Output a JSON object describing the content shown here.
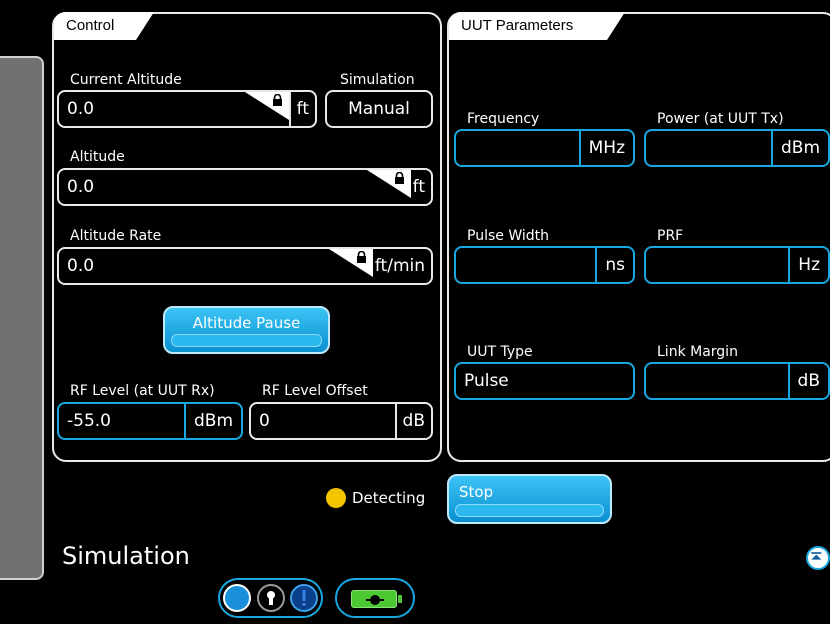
{
  "control": {
    "title": "Control",
    "current_altitude": {
      "label": "Current Altitude",
      "value": "0.0",
      "unit": "ft"
    },
    "simulation": {
      "label": "Simulation",
      "value": "Manual"
    },
    "altitude": {
      "label": "Altitude",
      "value": "0.0",
      "unit": "ft"
    },
    "altitude_rate": {
      "label": "Altitude Rate",
      "value": "0.0",
      "unit": "ft/min"
    },
    "altitude_pause_label": "Altitude Pause",
    "rf_level": {
      "label": "RF Level (at UUT Rx)",
      "value": "-55.0",
      "unit": "dBm"
    },
    "rf_level_offset": {
      "label": "RF Level Offset",
      "value": "0",
      "unit": "dB"
    }
  },
  "uut": {
    "title": "UUT Parameters",
    "frequency": {
      "label": "Frequency",
      "value": "",
      "unit": "MHz"
    },
    "power": {
      "label": "Power (at UUT Tx)",
      "value": "",
      "unit": "dBm"
    },
    "pulse_width": {
      "label": "Pulse Width",
      "value": "",
      "unit": "ns"
    },
    "prf": {
      "label": "PRF",
      "value": "",
      "unit": "Hz"
    },
    "uut_type": {
      "label": "UUT Type",
      "value": "Pulse"
    },
    "link_margin": {
      "label": "Link Margin",
      "value": "",
      "unit": "dB"
    }
  },
  "status": {
    "text": "Detecting",
    "color": "#f5c400"
  },
  "stop_label": "Stop",
  "footer": {
    "title": "Simulation"
  },
  "colors": {
    "accent": "#19a7e0",
    "button": "#0a8fd0",
    "battery": "#4cc832"
  }
}
